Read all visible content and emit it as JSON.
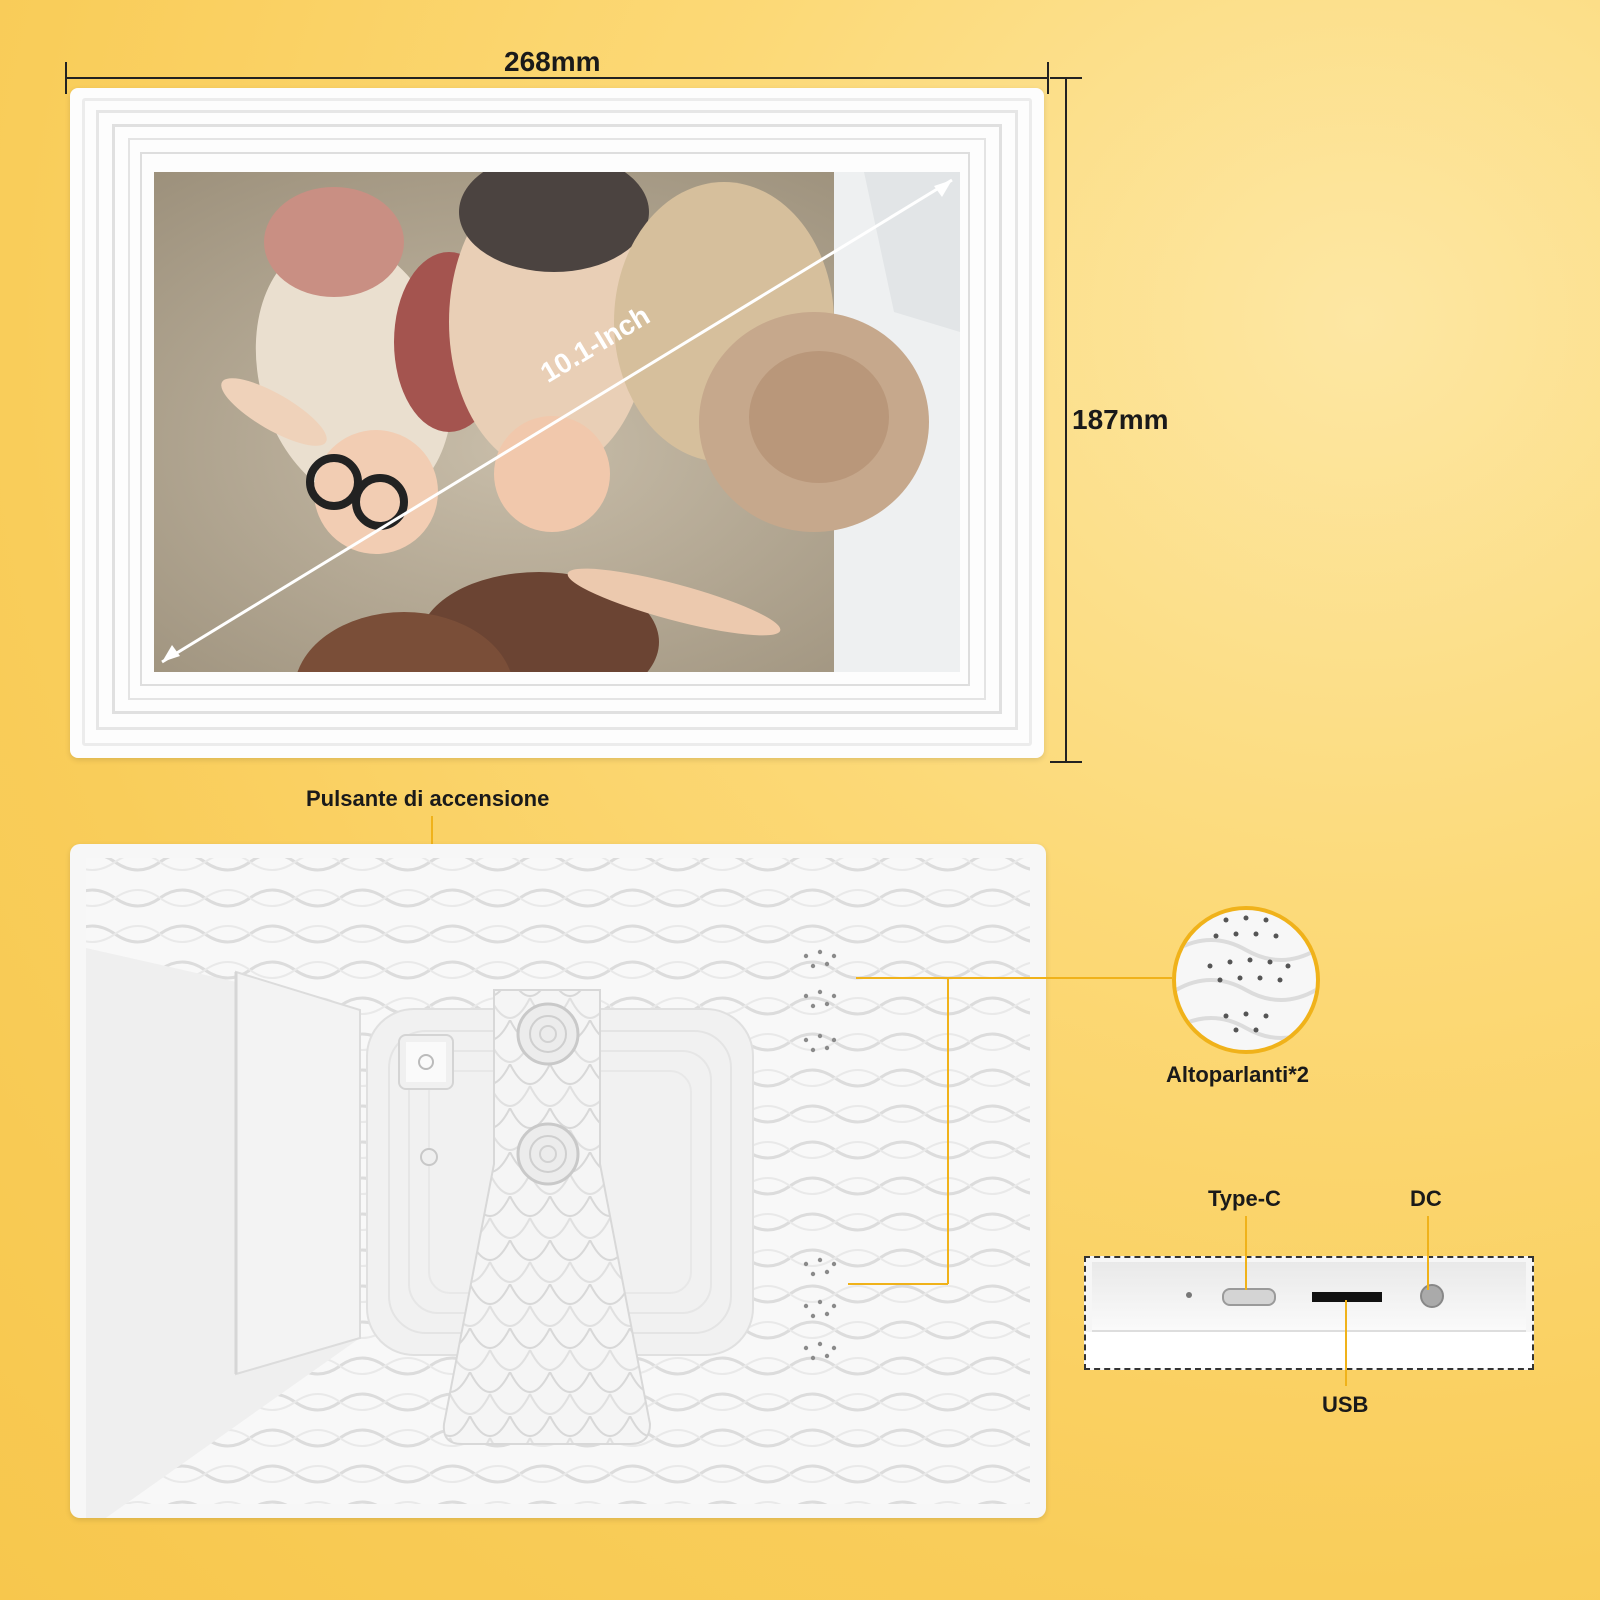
{
  "dimensions": {
    "width": "268mm",
    "height": "187mm",
    "diagonal": "10.1-Inch"
  },
  "labels": {
    "power_button": "Pulsante di accensione",
    "speakers": "Altoparlanti*2",
    "type_c": "Type-C",
    "dc": "DC",
    "usb": "USB"
  },
  "colors": {
    "background": "#f9cd5a",
    "callout_line": "#f0b21a",
    "frame": "#ffffff"
  }
}
